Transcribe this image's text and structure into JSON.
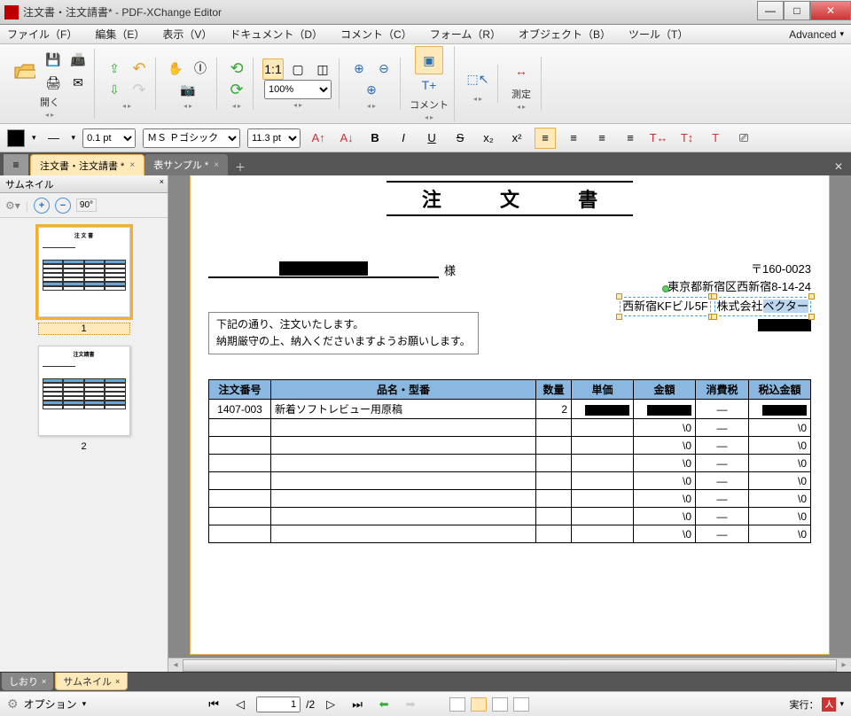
{
  "window": {
    "title": "注文書・注文請書* - PDF-XChange Editor"
  },
  "menu": {
    "file": "ファイル（F）",
    "edit": "編集（E）",
    "view": "表示（V）",
    "document": "ドキュメント（D）",
    "comment": "コメント（C）",
    "form": "フォーム（R）",
    "object": "オブジェクト（B）",
    "tool": "ツール（T）",
    "advanced": "Advanced"
  },
  "toolbar": {
    "open": "開く",
    "zoom_value": "100%",
    "comment": "コメント",
    "measure": "測定"
  },
  "format": {
    "line_width": "0.1 pt",
    "font": "ＭＳ Ｐゴシック",
    "size": "11.3 pt"
  },
  "tabs": {
    "active": "注文書・注文請書 *",
    "inactive": "表サンプル *"
  },
  "sidepanel": {
    "title": "サムネイル",
    "rotate": "90°",
    "page1": "1",
    "page2": "2"
  },
  "bottom_tabs": {
    "bookmarks": "しおり",
    "thumbnails": "サムネイル"
  },
  "statusbar": {
    "options": "オプション",
    "page": "1",
    "total": "/2",
    "exec": "実行："
  },
  "doc": {
    "title": "注 文 書",
    "recipient_sama": "様",
    "sender": {
      "postal": "〒160-0023",
      "addr1": "東京都新宿区西新宿",
      "addr1_suffix": "8-14-24",
      "addr2": "西新宿KFビル5F",
      "company_prefix": "株式会社",
      "company_sel": "ベクター"
    },
    "note_l1": "下記の通り、注文いたします。",
    "note_l2": "納期厳守の上、納入くださいますようお願いします。",
    "headers": [
      "注文番号",
      "品名・型番",
      "数量",
      "単価",
      "金額",
      "消費税",
      "税込金額"
    ],
    "rows": [
      {
        "no": "1407-003",
        "name": "新着ソフトレビュー用原稿",
        "qty": "2",
        "price": "[R]",
        "amount": "[R]",
        "tax": "—",
        "total": "[R]"
      },
      {
        "no": "",
        "name": "",
        "qty": "",
        "price": "",
        "amount": "\\0",
        "tax": "—",
        "total": "\\0"
      },
      {
        "no": "",
        "name": "",
        "qty": "",
        "price": "",
        "amount": "\\0",
        "tax": "—",
        "total": "\\0"
      },
      {
        "no": "",
        "name": "",
        "qty": "",
        "price": "",
        "amount": "\\0",
        "tax": "—",
        "total": "\\0"
      },
      {
        "no": "",
        "name": "",
        "qty": "",
        "price": "",
        "amount": "\\0",
        "tax": "—",
        "total": "\\0"
      },
      {
        "no": "",
        "name": "",
        "qty": "",
        "price": "",
        "amount": "\\0",
        "tax": "—",
        "total": "\\0"
      },
      {
        "no": "",
        "name": "",
        "qty": "",
        "price": "",
        "amount": "\\0",
        "tax": "—",
        "total": "\\0"
      },
      {
        "no": "",
        "name": "",
        "qty": "",
        "price": "",
        "amount": "\\0",
        "tax": "—",
        "total": "\\0"
      }
    ]
  }
}
